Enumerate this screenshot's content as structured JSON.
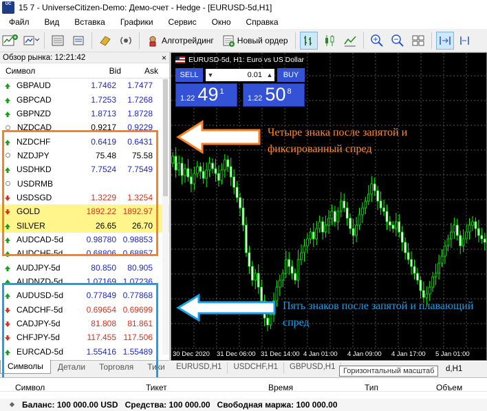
{
  "window": {
    "title": "15   7 - UniverseCitizen-Demo: Демо-счет - Hedge - [EURUSD-5d,H1]",
    "app_icon_text": "Universe Citizen"
  },
  "menu": [
    "Файл",
    "Вид",
    "Вставка",
    "Графики",
    "Сервис",
    "Окно",
    "Справка"
  ],
  "toolbar": {
    "algotrading": "Алготрейдинг",
    "new_order": "Новый ордер"
  },
  "market_watch": {
    "header": "Обзор рынка: 12:21:42",
    "close": "×",
    "col_symbol": "Символ",
    "col_bid": "Bid",
    "col_ask": "Ask",
    "rows": [
      {
        "symbol": "GBPAUD",
        "bid": "1.7462",
        "ask": "1.7477",
        "dir": "up",
        "color": "blue",
        "hl": false
      },
      {
        "symbol": "GBPCAD",
        "bid": "1.7253",
        "ask": "1.7268",
        "dir": "up",
        "color": "blue",
        "hl": false
      },
      {
        "symbol": "GBPNZD",
        "bid": "1.8713",
        "ask": "1.8728",
        "dir": "up",
        "color": "blue",
        "hl": false
      },
      {
        "symbol": "NZDCAD",
        "bid": "0.9217",
        "ask": "0.9229",
        "dir": "neutral",
        "color": "mixed",
        "hl": false
      },
      {
        "symbol": "NZDCHF",
        "bid": "0.6419",
        "ask": "0.6431",
        "dir": "up",
        "color": "blue",
        "hl": false
      },
      {
        "symbol": "NZDJPY",
        "bid": "75.48",
        "ask": "75.58",
        "dir": "neutral",
        "color": "black",
        "hl": false
      },
      {
        "symbol": "USDHKD",
        "bid": "7.7524",
        "ask": "7.7549",
        "dir": "up",
        "color": "blue",
        "hl": false
      },
      {
        "symbol": "USDRMB",
        "bid": "",
        "ask": "",
        "dir": "neutral",
        "color": "black",
        "hl": false
      },
      {
        "symbol": "USDSGD",
        "bid": "1.3229",
        "ask": "1.3254",
        "dir": "down",
        "color": "red",
        "hl": false
      },
      {
        "symbol": "GOLD",
        "bid": "1892.22",
        "ask": "1892.97",
        "dir": "down",
        "color": "red",
        "hl": true
      },
      {
        "symbol": "SILVER",
        "bid": "26.65",
        "ask": "26.70",
        "dir": "up",
        "color": "black",
        "hl": true
      },
      {
        "symbol": "AUDCAD-5d",
        "bid": "0.98780",
        "ask": "0.98853",
        "dir": "up",
        "color": "blue",
        "hl": false
      },
      {
        "symbol": "AUDCHF-5d",
        "bid": "0.68806",
        "ask": "0.68857",
        "dir": "up",
        "color": "blue",
        "hl": false
      },
      {
        "symbol": "AUDJPY-5d",
        "bid": "80.850",
        "ask": "80.905",
        "dir": "up",
        "color": "blue",
        "hl": false
      },
      {
        "symbol": "AUDNZD-5d",
        "bid": "1.07169",
        "ask": "1.07236",
        "dir": "up",
        "color": "blue",
        "hl": false
      },
      {
        "symbol": "AUDUSD-5d",
        "bid": "0.77849",
        "ask": "0.77868",
        "dir": "up",
        "color": "blue",
        "hl": false
      },
      {
        "symbol": "CADCHF-5d",
        "bid": "0.69654",
        "ask": "0.69699",
        "dir": "down",
        "color": "red",
        "hl": false
      },
      {
        "symbol": "CADJPY-5d",
        "bid": "81.808",
        "ask": "81.861",
        "dir": "down",
        "color": "red",
        "hl": false
      },
      {
        "symbol": "CHFJPY-5d",
        "bid": "117.455",
        "ask": "117.506",
        "dir": "down",
        "color": "red",
        "hl": false
      },
      {
        "symbol": "EURCAD-5d",
        "bid": "1.55416",
        "ask": "1.55489",
        "dir": "up",
        "color": "blue",
        "hl": false
      }
    ],
    "tabs": [
      "Символы",
      "Детали",
      "Торговля",
      "Тики"
    ]
  },
  "chart": {
    "title": "EURUSD-5d, H1:  Euro vs US Dollar",
    "sell_label": "SELL",
    "buy_label": "BUY",
    "lot": "0.01",
    "sell_small": "1.22",
    "sell_big": "49",
    "sell_sup": "1",
    "buy_small": "1.22",
    "buy_big": "50",
    "buy_sup": "8",
    "annotation_orange": "Четыре знака после запятой и фиксированный спред",
    "annotation_blue": "Пять знаков после запятой и плавающий спред",
    "x_labels": [
      "30 Dec 2020",
      "31 Dec 06:00",
      "31 Dec 14:00",
      "4 Jan 01:00",
      "4 Jan 09:00",
      "4 Jan 17:00",
      "5 Jan 01:00"
    ],
    "tabs": [
      "EURUSD,H1",
      "USDCHF,H1",
      "GBPUSD,H1"
    ],
    "tooltip": "Горизонтальный масштаб",
    "tab_tail": "d,H1"
  },
  "terminal": {
    "cols": [
      "Символ",
      "Тикет",
      "Время",
      "Тип",
      "Объем"
    ],
    "balance": "Баланс: 100 000.00 USD",
    "equity": "Средства: 100 000.00",
    "free_margin": "Свободная маржа: 100 000.00"
  },
  "colors": {
    "orange": "#ff7f1e",
    "blue": "#1aa0ea",
    "candle": "#00ff00",
    "trade_btn": "#3352d6"
  }
}
